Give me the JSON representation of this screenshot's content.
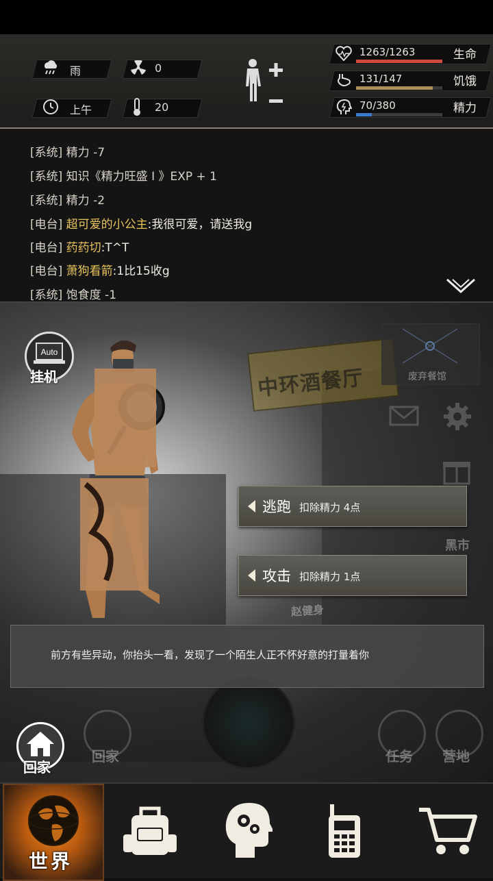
{
  "status": {
    "weather": "雨",
    "radiation": "0",
    "time_of_day": "上午",
    "temperature": "20",
    "hp": {
      "value": "1263/1263",
      "label": "生命",
      "fraction": 1.0,
      "color": "#d04a40"
    },
    "hunger": {
      "value": "131/147",
      "label": "饥饿",
      "fraction": 0.89,
      "color": "#b0905a"
    },
    "energy": {
      "value": "70/380",
      "label": "精力",
      "fraction": 0.18,
      "color": "#3a7ac8"
    }
  },
  "log": [
    {
      "tag": "[系统]",
      "name": "",
      "text": "精力 -7"
    },
    {
      "tag": "[系统]",
      "name": "",
      "text": "知识《精力旺盛 I 》EXP + 1"
    },
    {
      "tag": "[系统]",
      "name": "",
      "text": "精力 -2"
    },
    {
      "tag": "[电台]",
      "name": "超可爱的小公主",
      "text": ":我很可爱，请送我g"
    },
    {
      "tag": "[电台]",
      "name": "药药切",
      "text": ":T^T"
    },
    {
      "tag": "[电台]",
      "name": "萧狗看箭",
      "text": ":1比15收g"
    },
    {
      "tag": "[系统]",
      "name": "",
      "text": "饱食度 -1"
    }
  ],
  "scene": {
    "auto_label": "Auto",
    "idle_label": "挂机",
    "location_label": "废弃餐馆",
    "sign_text": "中环酒餐厅",
    "black_market_label": "黑市",
    "gym_label": "赵健身"
  },
  "actions": {
    "flee": {
      "label": "逃跑",
      "cost": "扣除精力 4点"
    },
    "attack": {
      "label": "攻击",
      "cost": "扣除精力 1点"
    }
  },
  "event_text": "前方有些异动，你抬头一看，发现了一个陌生人正不怀好意的打量着你",
  "bottom_shortcuts": {
    "home": "回家",
    "home_ghost": "回家",
    "task": "任务",
    "camp": "营地"
  },
  "nav": {
    "world": "世界"
  }
}
